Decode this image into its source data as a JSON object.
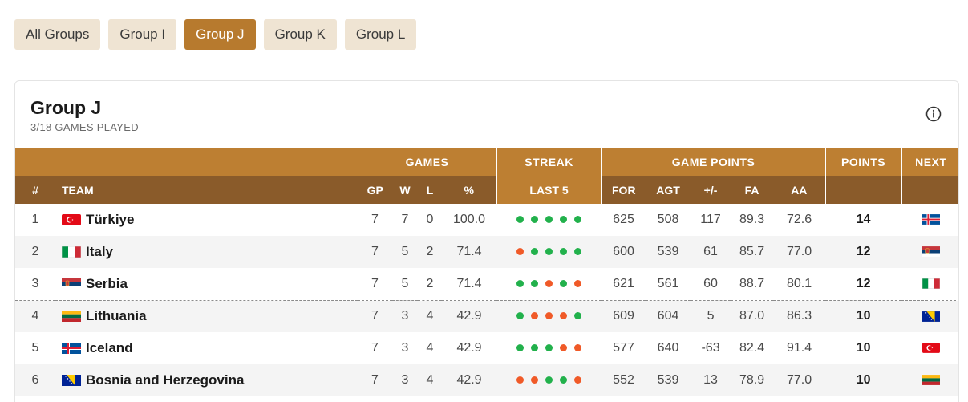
{
  "tabs": [
    {
      "label": "All Groups",
      "active": false
    },
    {
      "label": "Group I",
      "active": false
    },
    {
      "label": "Group J",
      "active": true
    },
    {
      "label": "Group K",
      "active": false
    },
    {
      "label": "Group L",
      "active": false
    }
  ],
  "card": {
    "title": "Group J",
    "subtitle": "3/18 GAMES PLAYED",
    "info_icon": "info-icon"
  },
  "header_groups": {
    "games": "GAMES",
    "streak": "STREAK",
    "game_points": "GAME POINTS",
    "points": "POINTS",
    "next": "NEXT"
  },
  "columns": {
    "rank": "#",
    "team": "TEAM",
    "gp": "GP",
    "w": "W",
    "l": "L",
    "pct": "%",
    "last5": "LAST 5",
    "for": "FOR",
    "agt": "AGT",
    "diff": "+/-",
    "fa": "FA",
    "aa": "AA"
  },
  "colors": {
    "accent": "#bd7f32",
    "accent_dark": "#8a5b2a",
    "tab_bg": "#efe4d3",
    "win": "#22b14c",
    "loss": "#f05a28"
  },
  "rows": [
    {
      "rank": "1",
      "team": "Türkiye",
      "flag": "turkey-flag-icon",
      "gp": "7",
      "w": "7",
      "l": "0",
      "pct": "100.0",
      "last5": [
        "W",
        "W",
        "W",
        "W",
        "W"
      ],
      "for": "625",
      "agt": "508",
      "diff": "117",
      "fa": "89.3",
      "aa": "72.6",
      "points": "14",
      "next": "iceland-flag-icon"
    },
    {
      "rank": "2",
      "team": "Italy",
      "flag": "italy-flag-icon",
      "gp": "7",
      "w": "5",
      "l": "2",
      "pct": "71.4",
      "last5": [
        "L",
        "W",
        "W",
        "W",
        "W"
      ],
      "for": "600",
      "agt": "539",
      "diff": "61",
      "fa": "85.7",
      "aa": "77.0",
      "points": "12",
      "next": "serbia-flag-icon"
    },
    {
      "rank": "3",
      "team": "Serbia",
      "flag": "serbia-flag-icon",
      "gp": "7",
      "w": "5",
      "l": "2",
      "pct": "71.4",
      "last5": [
        "W",
        "W",
        "L",
        "W",
        "L"
      ],
      "for": "621",
      "agt": "561",
      "diff": "60",
      "fa": "88.7",
      "aa": "80.1",
      "points": "12",
      "next": "italy-flag-icon"
    },
    {
      "rank": "4",
      "team": "Lithuania",
      "flag": "lithuania-flag-icon",
      "gp": "7",
      "w": "3",
      "l": "4",
      "pct": "42.9",
      "last5": [
        "W",
        "L",
        "L",
        "L",
        "W"
      ],
      "for": "609",
      "agt": "604",
      "diff": "5",
      "fa": "87.0",
      "aa": "86.3",
      "points": "10",
      "next": "bosnia-flag-icon"
    },
    {
      "rank": "5",
      "team": "Iceland",
      "flag": "iceland-flag-icon",
      "gp": "7",
      "w": "3",
      "l": "4",
      "pct": "42.9",
      "last5": [
        "W",
        "W",
        "W",
        "L",
        "L"
      ],
      "for": "577",
      "agt": "640",
      "diff": "-63",
      "fa": "82.4",
      "aa": "91.4",
      "points": "10",
      "next": "turkey-flag-icon"
    },
    {
      "rank": "6",
      "team": "Bosnia and Herzegovina",
      "flag": "bosnia-flag-icon",
      "gp": "7",
      "w": "3",
      "l": "4",
      "pct": "42.9",
      "last5": [
        "L",
        "L",
        "W",
        "W",
        "L"
      ],
      "for": "552",
      "agt": "539",
      "diff": "13",
      "fa": "78.9",
      "aa": "77.0",
      "points": "10",
      "next": "lithuania-flag-icon"
    }
  ]
}
